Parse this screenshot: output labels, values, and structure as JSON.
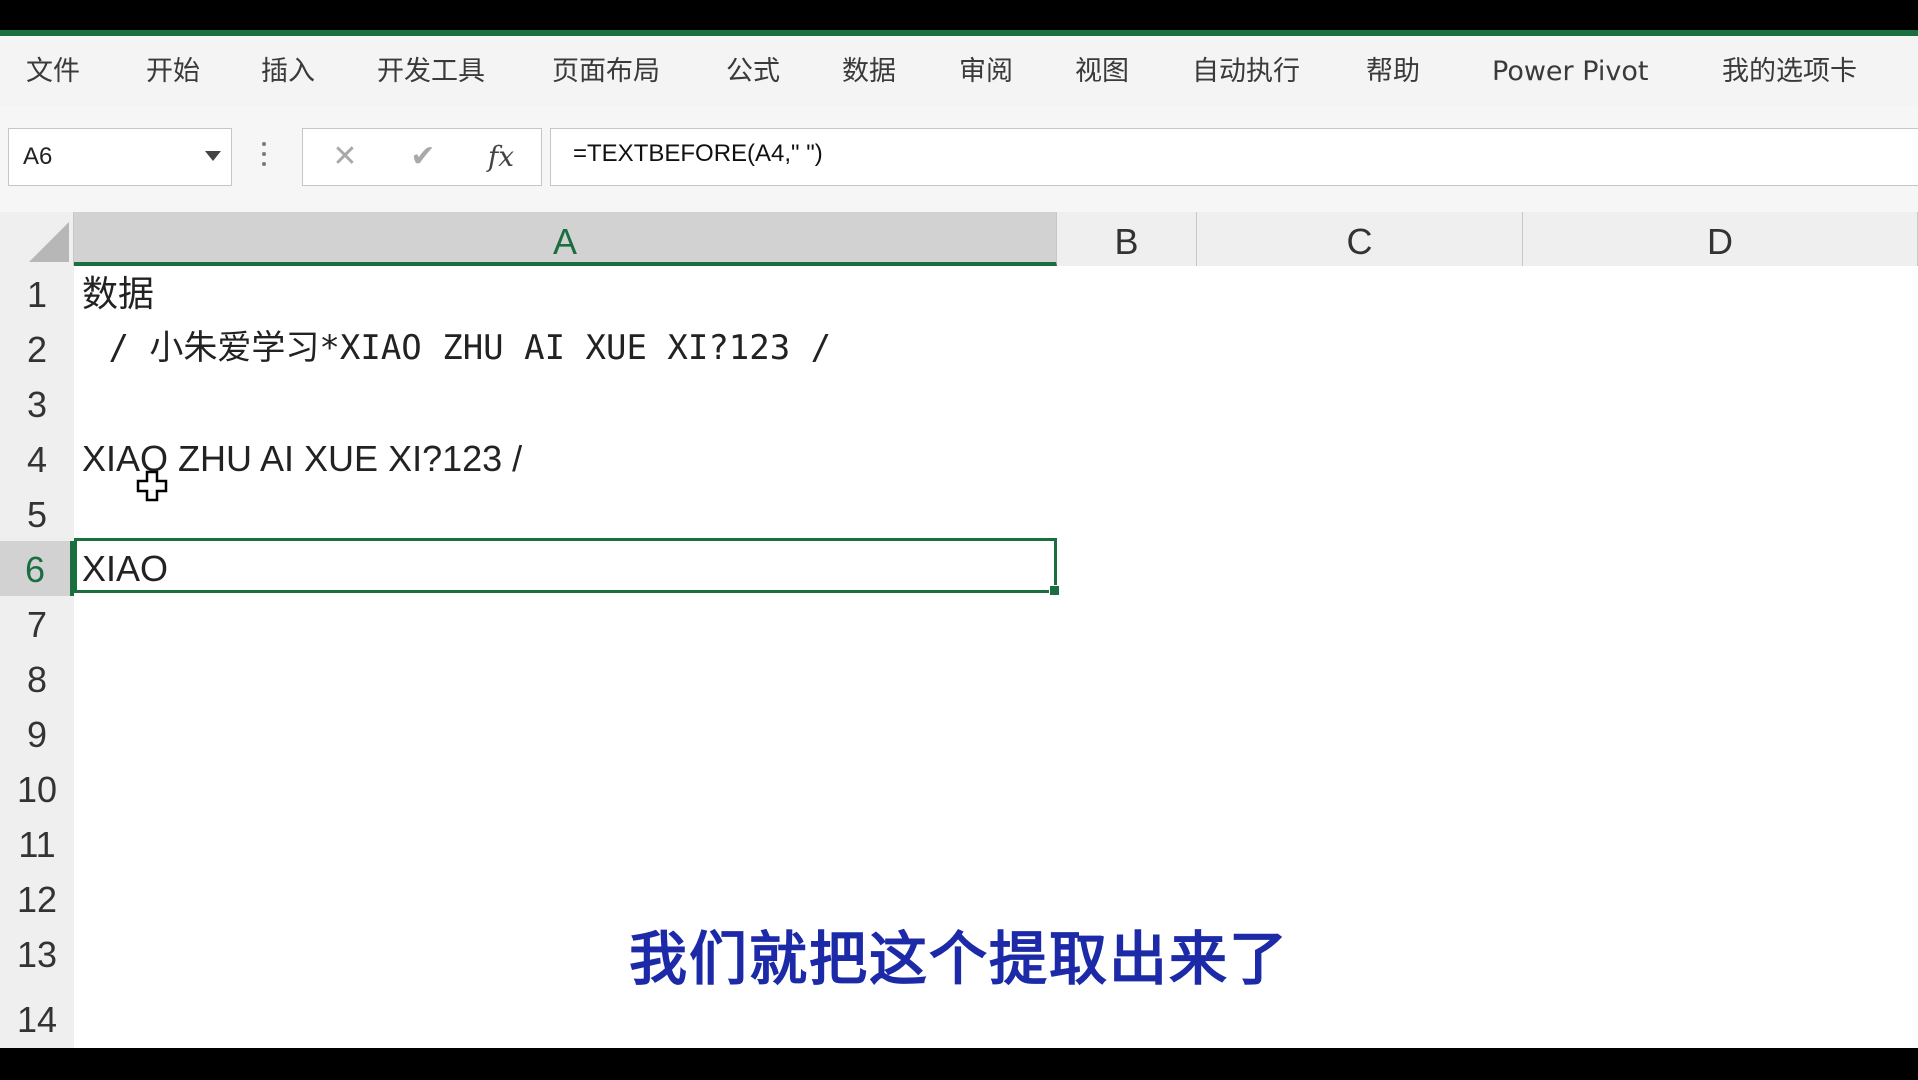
{
  "ribbon": {
    "tabs": [
      "文件",
      "开始",
      "插入",
      "开发工具",
      "页面布局",
      "公式",
      "数据",
      "审阅",
      "视图",
      "自动执行",
      "帮助",
      "Power Pivot",
      "我的选项卡"
    ]
  },
  "formula_bar": {
    "name_box": "A6",
    "cancel_icon": "✕",
    "enter_icon": "✔",
    "fx_label": "fx",
    "formula": "=TEXTBEFORE(A4,\" \")"
  },
  "columns": [
    "A",
    "B",
    "C",
    "D"
  ],
  "rows": [
    "1",
    "2",
    "3",
    "4",
    "5",
    "6",
    "7",
    "8",
    "9",
    "10",
    "11",
    "12",
    "13",
    "14"
  ],
  "cells": {
    "A1": "数据",
    "A2": " / 小朱爱学习*XIAO ZHU AI XUE XI?123 /",
    "A4": "XIAO ZHU AI XUE XI?123 /",
    "A6": "XIAO"
  },
  "selection": {
    "active_cell": "A6",
    "active_column": "A",
    "active_row": "6"
  },
  "subtitle": "我们就把这个提取出来了",
  "colors": {
    "accent": "#1b6e40",
    "subtitle": "#1c2aa8"
  }
}
